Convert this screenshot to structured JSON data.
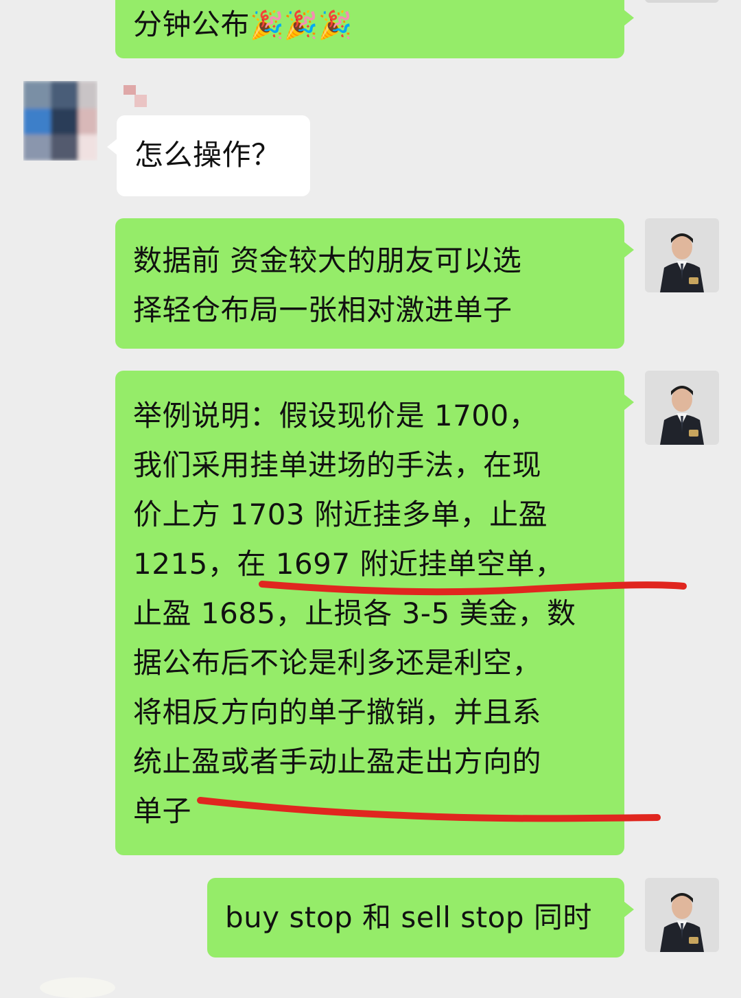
{
  "messages": [
    {
      "id": "m1",
      "side": "outgoing",
      "text": "分钟公布",
      "emoji": "🎉🎉🎉"
    },
    {
      "id": "m2",
      "side": "incoming",
      "text": "怎么操作？"
    },
    {
      "id": "m3",
      "side": "outgoing",
      "text": "数据前 资金较大的朋友可以选\n择轻仓布局一张相对激进单子"
    },
    {
      "id": "m4",
      "side": "outgoing",
      "text": "举例说明：假设现价是 1700，\n我们采用挂单进场的手法，在现\n价上方 1703 附近挂多单，止盈\n1215，在 1697 附近挂单空单，\n止盈 1685，止损各 3-5 美金，数\n据公布后不论是利多还是利空，\n将相反方向的单子撤销，并且系\n统止盈或者手动止盈走出方向的\n单子"
    },
    {
      "id": "m5",
      "side": "outgoing",
      "text": "buy stop 和 sell stop 同时"
    }
  ],
  "colors": {
    "background": "#ededed",
    "outgoing_bubble": "#95ec69",
    "incoming_bubble": "#ffffff",
    "annotation": "#e0261f"
  },
  "icons": {
    "party": "party-popper-icon"
  }
}
